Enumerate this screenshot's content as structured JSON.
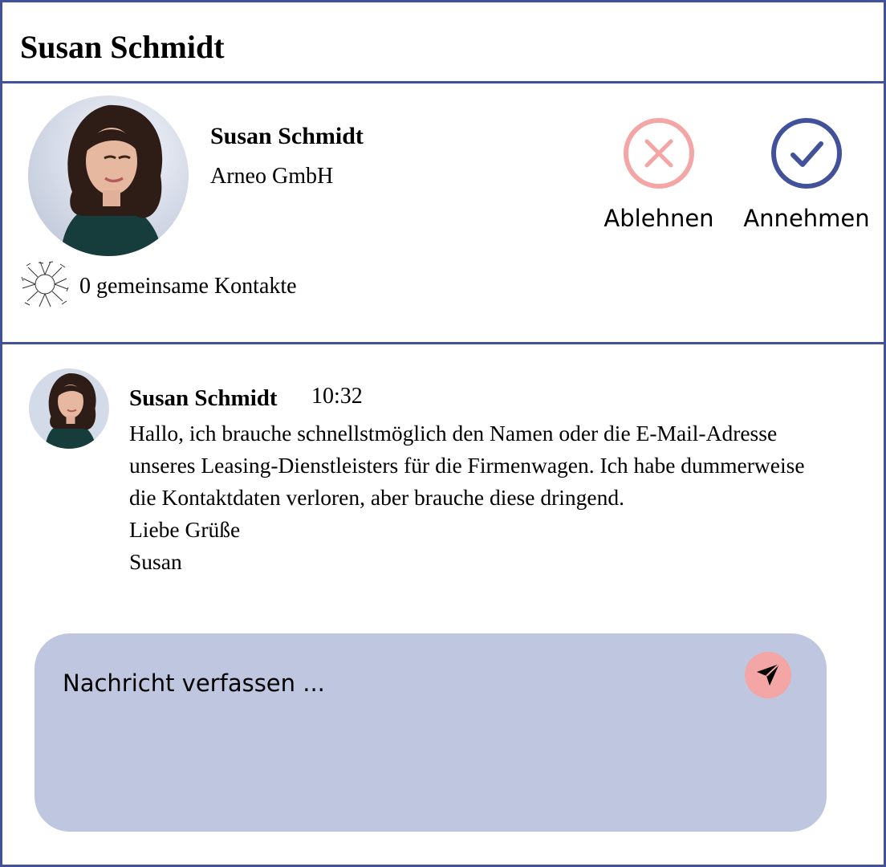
{
  "header": {
    "title": "Susan Schmidt"
  },
  "request": {
    "name": "Susan Schmidt",
    "company": "Arneo GmbH",
    "reject_label": "Ablehnen",
    "accept_label": "Annehmen",
    "mutual_contacts": "0 gemeinsame Kontakte"
  },
  "message": {
    "author": "Susan Schmidt",
    "time": "10:32",
    "lines": [
      "Hallo, ich brauche schnellstmöglich den Namen oder die E-Mail-Adresse",
      "unseres Leasing-Dienstleisters für die Firmenwagen. Ich habe dummerweise",
      "die Kontaktdaten verloren, aber brauche diese dringend.",
      "Liebe Grüße",
      "Susan"
    ]
  },
  "composer": {
    "placeholder": "Nachricht verfassen ..."
  },
  "icons": {
    "reject": "close-circle-icon",
    "accept": "check-circle-icon",
    "contacts": "connected-hands-icon",
    "send": "paper-plane-icon"
  },
  "colors": {
    "border": "#42529a",
    "reject": "#f4a5a5",
    "accept": "#42529a",
    "composer_bg": "#bfc7e0",
    "send_bg": "#f4a5a5"
  }
}
